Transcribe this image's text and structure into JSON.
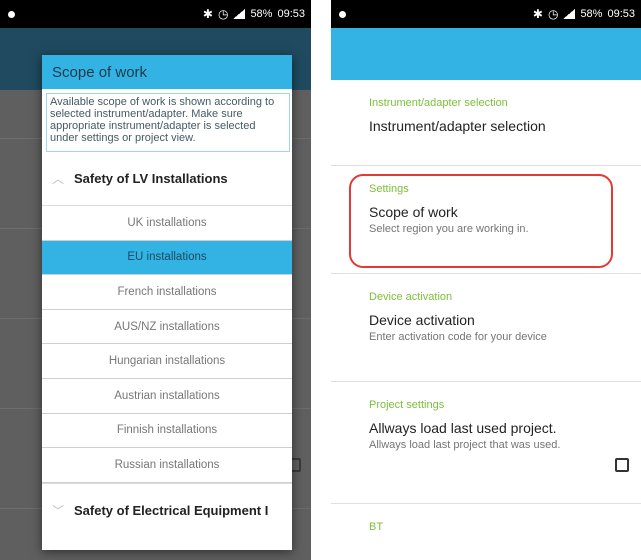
{
  "left": {
    "status": {
      "battery": "58%",
      "time": "09:53"
    },
    "dialog": {
      "title": "Scope of work",
      "info": "Available scope of work is shown according to selected instrument/adapter. Make sure appropriate instrument/adapter is selected under settings or project view.",
      "group_top": "Safety of LV Installations",
      "options": [
        "UK installations",
        "EU installations",
        "French  installations",
        "AUS/NZ installations",
        "Hungarian installations",
        "Austrian installations",
        "Finnish installations",
        "Russian installations"
      ],
      "selected_option": "EU installations",
      "group_bottom": "Safety of Electrical Equipment I"
    }
  },
  "right": {
    "status": {
      "battery": "58%",
      "time": "09:53"
    },
    "sections": [
      {
        "header": "Instrument/adapter selection",
        "title": "Instrument/adapter selection",
        "subtitle": ""
      },
      {
        "header": "Settings",
        "title": "Scope of work",
        "subtitle": "Select region you are working in."
      },
      {
        "header": "Device activation",
        "title": "Device activation",
        "subtitle": "Enter activation code for your device"
      },
      {
        "header": "Project settings",
        "title": "Allways load last used project.",
        "subtitle": "Allways load last project that was used."
      },
      {
        "header": "BT",
        "title": "",
        "subtitle": ""
      }
    ]
  },
  "colors": {
    "accent": "#32b3e4",
    "header_green": "#7cbf3b",
    "highlight_red": "#e53935"
  }
}
